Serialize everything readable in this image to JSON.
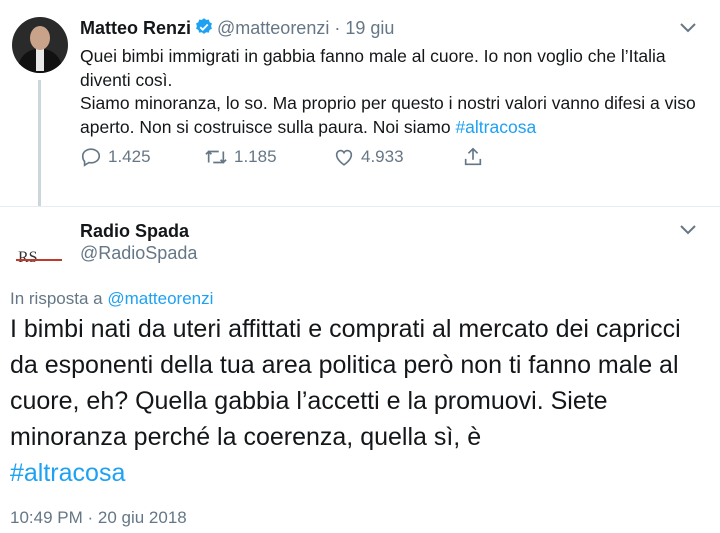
{
  "tweet1": {
    "author_name": "Matteo Renzi",
    "handle": "@matteorenzi",
    "separator": "·",
    "date": "19 giu",
    "text_line1": "Quei bimbi immigrati in gabbia fanno male al cuore. Io non voglio che l’Italia diventi così.",
    "text_line2_prefix": "Siamo minoranza, lo so. Ma proprio per questo i nostri valori vanno difesi a viso aperto. Non si costruisce sulla paura. Noi siamo ",
    "hashtag": "#altracosa",
    "reply_count": "1.425",
    "retweet_count": "1.185",
    "like_count": "4.933",
    "verified_icon": "verified-badge-icon"
  },
  "tweet2": {
    "author_name": "Radio Spada",
    "handle": "@RadioSpada",
    "avatar_text": "RS",
    "reply_prefix": "In risposta a ",
    "reply_mention": "@matteorenzi",
    "text_body": "I bimbi nati da uteri affittati e comprati al mercato dei capricci da esponenti della tua area politica però non ti fanno male al cuore, eh? Quella gabbia l’accetti e la promuovi. Siete minoranza perché la coerenza, quella sì, è",
    "hashtag": "#altracosa",
    "timestamp": "10:49 PM · 20 giu 2018"
  },
  "colors": {
    "accent": "#1da1f2",
    "muted": "#657786",
    "text": "#14171a",
    "divider": "#e6ecf0"
  }
}
